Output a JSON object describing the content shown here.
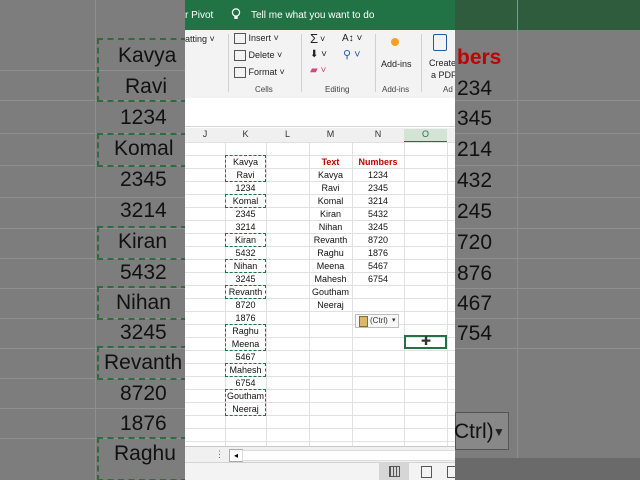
{
  "ribbon": {
    "pivot_fragment": "r Pivot",
    "tell_me": "Tell me what you want to do",
    "formatting_fragment": "atting",
    "insert": "Insert",
    "delete": "Delete",
    "format": "Format",
    "cells_group": "Cells",
    "editing_group": "Editing",
    "addins_button": "Add-ins",
    "addins_group": "Add-ins",
    "create_pdf_line1": "Create",
    "create_pdf_line2": "a PDF",
    "ad_fragment": "Ad"
  },
  "columns": [
    "J",
    "K",
    "L",
    "M",
    "N",
    "O"
  ],
  "column_k": [
    "Kavya",
    "Ravi",
    "1234",
    "Komal",
    "2345",
    "3214",
    "Kiran",
    "5432",
    "Nihan",
    "3245",
    "Revanth",
    "8720",
    "1876",
    "Raghu",
    "Meena",
    "5467",
    "Mahesh",
    "6754",
    "Goutham",
    "Neeraj"
  ],
  "table": {
    "text_header": "Text",
    "numbers_header": "Numbers",
    "text": [
      "Kavya",
      "Ravi",
      "Komal",
      "Kiran",
      "Nihan",
      "Revanth",
      "Raghu",
      "Meena",
      "Mahesh",
      "Goutham",
      "Neeraj"
    ],
    "numbers": [
      "1234",
      "2345",
      "3214",
      "5432",
      "3245",
      "8720",
      "1876",
      "5467",
      "6754"
    ]
  },
  "paste_options": "(Ctrl)",
  "background_left": [
    "Kavya",
    "Ravi",
    "1234",
    "Komal",
    "2345",
    "3214",
    "Kiran",
    "5432",
    "Nihan",
    "3245",
    "Revanth",
    "8720",
    "1876",
    "Raghu"
  ],
  "background_right": [
    "bers",
    "234",
    "345",
    "214",
    "432",
    "245",
    "720",
    "876",
    "467",
    "754",
    "Ctrl)"
  ],
  "colors": {
    "excel_green": "#217346",
    "header_red": "#c00000",
    "background": "#7d7d7d"
  }
}
